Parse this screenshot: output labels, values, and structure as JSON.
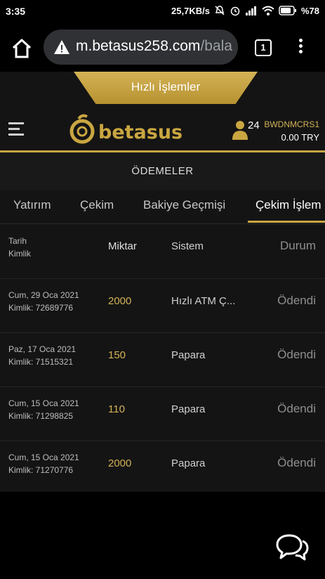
{
  "status_bar": {
    "time": "3:35",
    "network_speed": "25,7KB/s",
    "battery": "%78"
  },
  "browser": {
    "url_host": "m.betasus258.com",
    "url_path": "/bala",
    "tab_count": "1"
  },
  "site": {
    "quick_actions_label": "Hızlı İşlemler",
    "logo_text": "betasus",
    "notification_count": "24",
    "username": "BWDNMCRS1",
    "balance": "0.00 TRY",
    "section_title": "ÖDEMELER",
    "tabs": [
      {
        "label": "Yatırım"
      },
      {
        "label": "Çekim"
      },
      {
        "label": "Bakiye Geçmişi"
      },
      {
        "label": "Çekim İşlem"
      }
    ],
    "table": {
      "headers": {
        "date": "Tarih",
        "id": "Kimlik",
        "amount": "Miktar",
        "system": "Sistem",
        "status": "Durum"
      },
      "rows": [
        {
          "date": "Cum, 29 Oca 2021",
          "id": "Kimlik: 72689776",
          "amount": "2000",
          "system": "Hızlı ATM Ç...",
          "status": "Ödendi"
        },
        {
          "date": "Paz, 17 Oca 2021",
          "id": "Kimlik: 71515321",
          "amount": "150",
          "system": "Papara",
          "status": "Ödendi"
        },
        {
          "date": "Cum, 15 Oca 2021",
          "id": "Kimlik: 71298825",
          "amount": "110",
          "system": "Papara",
          "status": "Ödendi"
        },
        {
          "date": "Cum, 15 Oca 2021",
          "id": "Kimlik: 71270776",
          "amount": "2000",
          "system": "Papara",
          "status": "Ödendi"
        }
      ]
    }
  },
  "colors": {
    "accent_gold": "#c9a641",
    "background": "#141414"
  }
}
